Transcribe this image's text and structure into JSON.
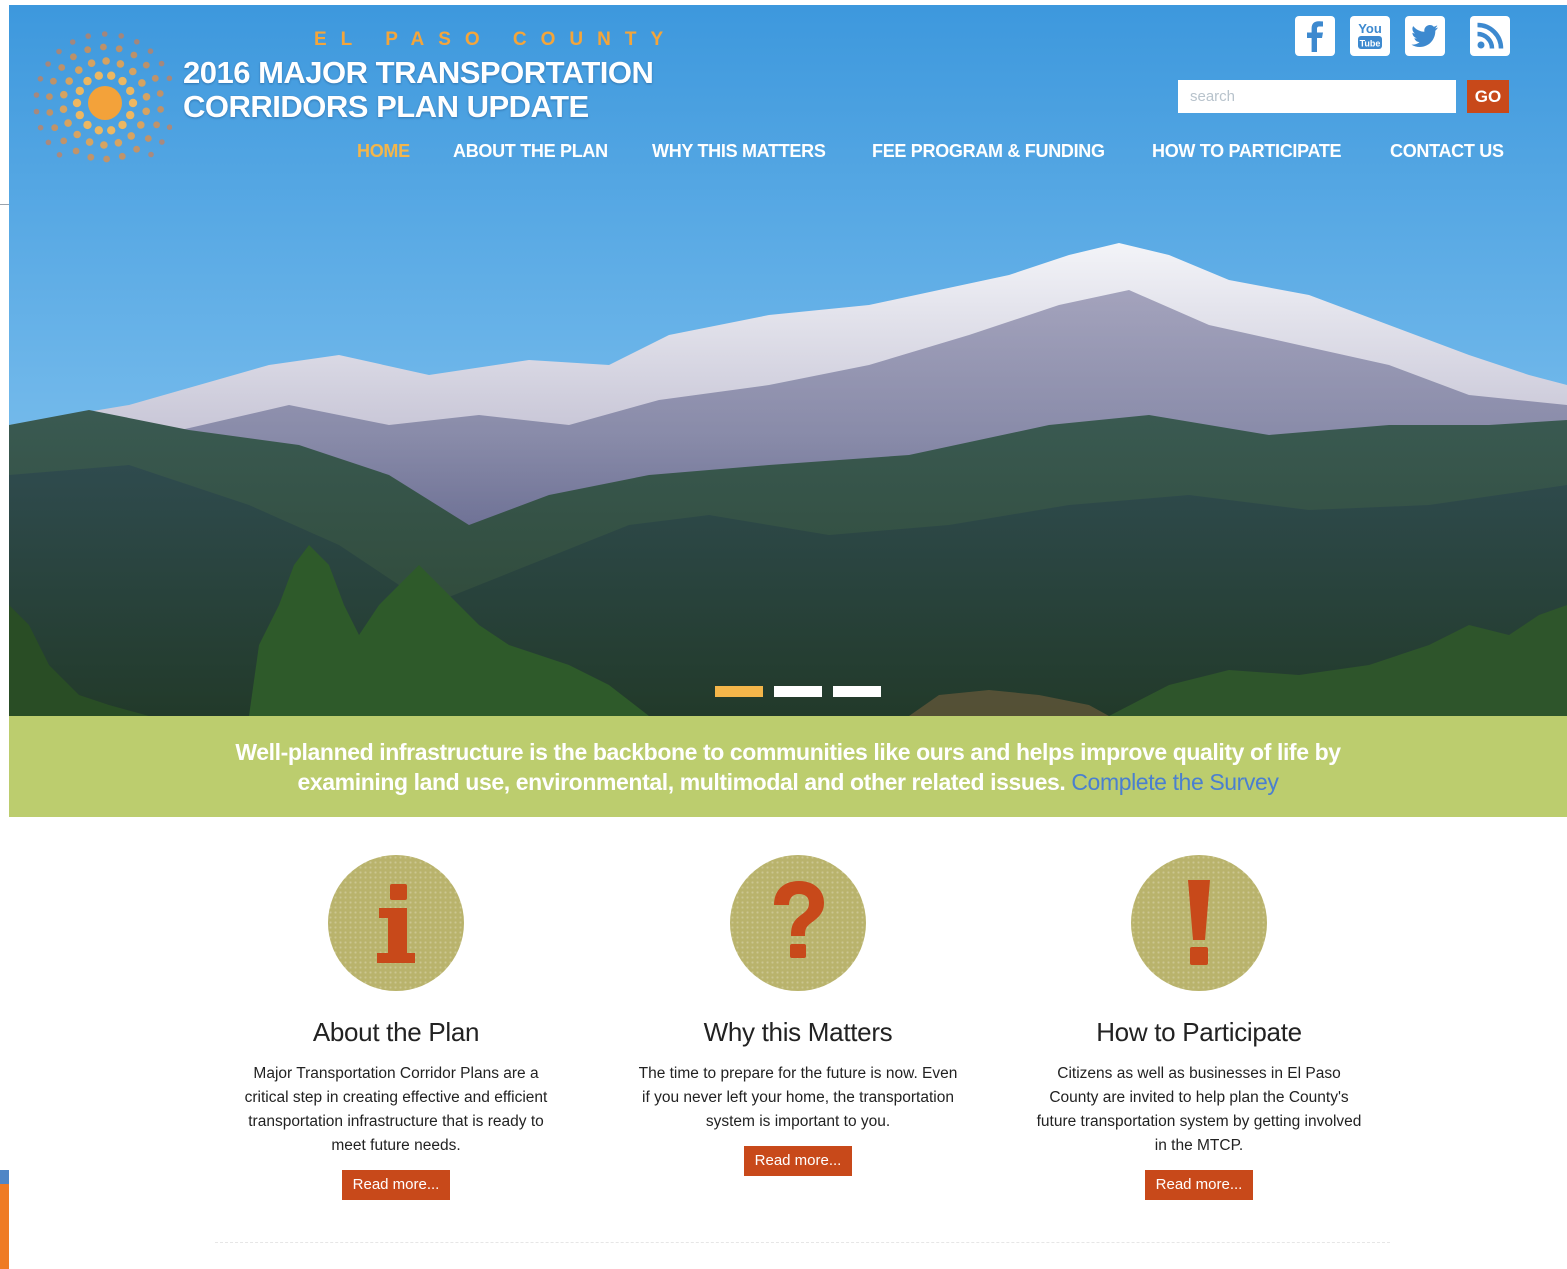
{
  "header": {
    "county": "EL PASO COUNTY",
    "title_line1": "2016 MAJOR TRANSPORTATION",
    "title_line2": "CORRIDORS PLAN UPDATE"
  },
  "social": [
    {
      "name": "facebook",
      "icon": "facebook-icon"
    },
    {
      "name": "youtube",
      "icon": "youtube-icon"
    },
    {
      "name": "twitter",
      "icon": "twitter-icon"
    },
    {
      "name": "rss",
      "icon": "rss-icon"
    }
  ],
  "search": {
    "placeholder": "search",
    "value": "",
    "button_label": "GO"
  },
  "nav": {
    "home": "HOME",
    "about": "ABOUT THE PLAN",
    "why": "WHY THIS MATTERS",
    "fee": "FEE PROGRAM & FUNDING",
    "participate": "HOW TO PARTICIPATE",
    "contact": "CONTACT US",
    "active": "HOME"
  },
  "slider": {
    "slides": 3,
    "active_index": 0
  },
  "banner": {
    "text_line1": "Well-planned infrastructure is the backbone to communities like ours and helps improve quality of life by",
    "text_line2": "examining land use, environmental, multimodal and other related issues.",
    "link": "Complete the Survey"
  },
  "features": [
    {
      "icon": "info-icon",
      "title": "About the Plan",
      "text": "Major Transportation Corridor Plans are a critical step in creating effective and efficient transportation infrastructure that is ready to meet future needs.",
      "button": "Read more..."
    },
    {
      "icon": "question-icon",
      "title": "Why this Matters",
      "text": "The time to prepare for the future is now. Even if you never left your home, the transportation system is important to you.",
      "button": "Read more..."
    },
    {
      "icon": "exclamation-icon",
      "title": "How to Participate",
      "text": "Citizens as well as businesses in El Paso County are invited to help plan the County's future transportation system by getting involved in the MTCP.",
      "button": "Read more..."
    }
  ],
  "colors": {
    "accent": "#c8491a",
    "nav_active": "#f4b64a",
    "banner": "#bccd6e",
    "survey_link": "#4a7fd0",
    "icon_circle": "#b9b36c",
    "sky": "#4f9fd8"
  }
}
